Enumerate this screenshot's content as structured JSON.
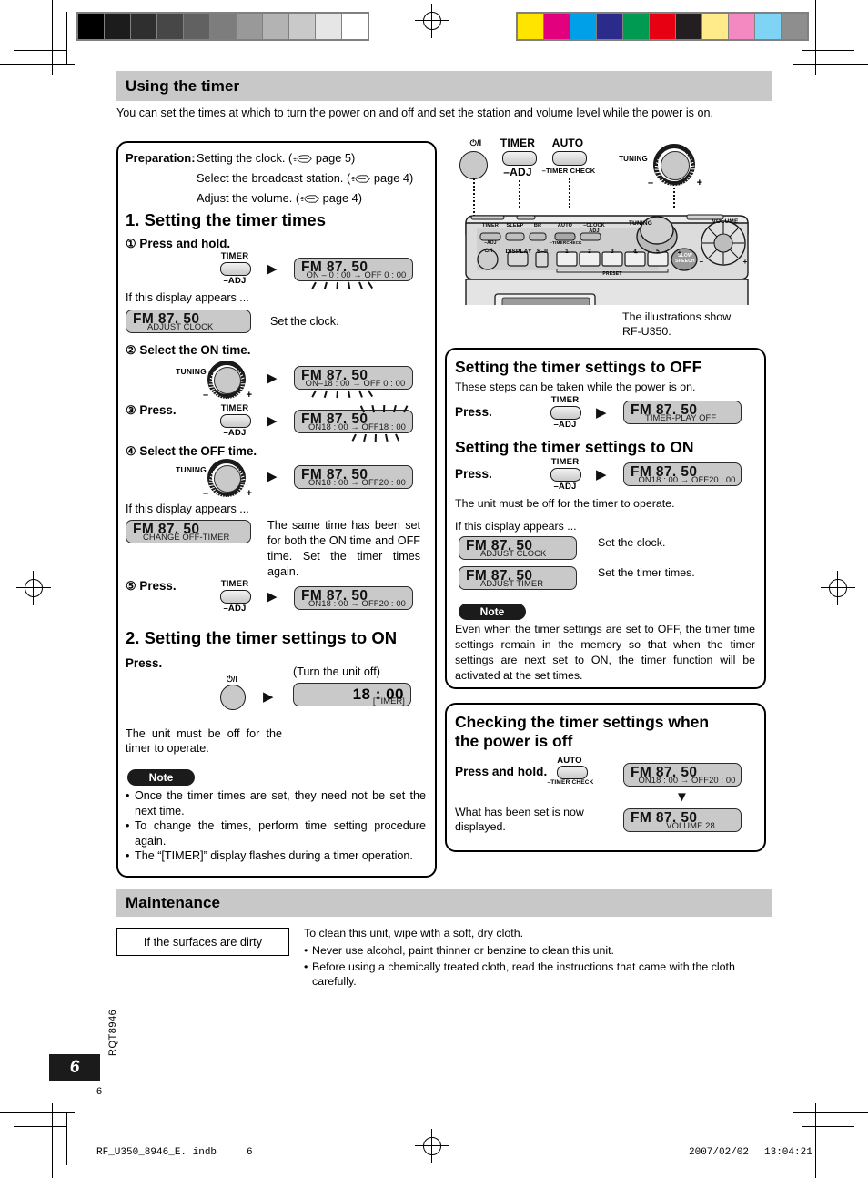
{
  "page": {
    "number_tab": "6",
    "number_small": "6",
    "doc_code": "RQT8946",
    "footer_file": "RF_U350_8946_E. indb     6",
    "footer_date": "2007/02/02",
    "footer_time": "13:04:21"
  },
  "calibration": {
    "gray_swatches": [
      "#000000",
      "#1c1c1c",
      "#2f2f2f",
      "#474747",
      "#616161",
      "#7d7d7d",
      "#999999",
      "#b3b3b3",
      "#c9c9c9",
      "#e6e6e6",
      "#ffffff"
    ],
    "color_swatches": [
      "#ffe400",
      "#e2007f",
      "#00a0e9",
      "#2b2b8c",
      "#009a52",
      "#e60012",
      "#231f20",
      "#ffeb8a",
      "#f488c1",
      "#7fd4f5",
      "#8e8e8e"
    ]
  },
  "sections": {
    "using_the_timer": {
      "title": "Using the timer",
      "intro": "You can set the times at which to turn the power on and off and set the station and volume level while the power is on."
    },
    "maintenance": {
      "title": "Maintenance",
      "left_box": "If the surfaces are dirty",
      "body_lead": "To clean this unit, wipe with a soft, dry cloth.",
      "bullets": [
        "Never use alcohol, paint thinner or benzine to clean this unit.",
        "Before using a chemically treated cloth, read the instructions that came with the cloth carefully."
      ]
    }
  },
  "preparation": {
    "label": "Preparation:",
    "lines": [
      {
        "text": "Setting the clock. (",
        "page": "page 5",
        "close": ")"
      },
      {
        "text": "Select the broadcast station. (",
        "page": "page 4",
        "close": ")"
      },
      {
        "text": "Adjust the volume. (",
        "page": "page 4",
        "close": ")"
      }
    ]
  },
  "illustration": {
    "caption_line1": "The illustrations show",
    "caption_line2": "RF-U350.",
    "callouts": {
      "power": "⏻/I",
      "timer": "TIMER",
      "timer_sub": "–ADJ",
      "auto": "AUTO",
      "auto_sub": "–TIMER CHECK",
      "tuning": "TUNING",
      "minus": "–",
      "plus": "+"
    },
    "panel": {
      "row1": [
        "TIMER",
        "SLEEP",
        "BR",
        "AUTO",
        "–CLOCK ADJ"
      ],
      "row1_subs": [
        "–ADJ",
        "",
        "",
        "–TIMERCHECK",
        ""
      ],
      "row2": [
        "⏻/I",
        "DISPLAY",
        "S–II"
      ],
      "presets": [
        "1",
        "2",
        "3",
        "4",
        "5"
      ],
      "preset_label": "PRESET",
      "slow_speech": "SLOW SPEECH",
      "tuning": "TUNING",
      "volume": "VOLUME"
    }
  },
  "step1": {
    "heading": "1. Setting the timer times",
    "items": [
      {
        "num": "①",
        "label": "Press and hold.",
        "control": "timer-button",
        "control_top": "TIMER",
        "control_bottom": "–ADJ"
      },
      {
        "num": "②",
        "label": "Select the ON time.",
        "control": "tuning-knob",
        "control_top": "TUNING"
      },
      {
        "num": "③",
        "label": "Press.",
        "control": "timer-button",
        "control_top": "TIMER",
        "control_bottom": "–ADJ"
      },
      {
        "num": "④",
        "label": "Select the OFF time.",
        "control": "tuning-knob",
        "control_top": "TUNING"
      },
      {
        "num": "⑤",
        "label": "Press.",
        "control": "timer-button",
        "control_top": "TIMER",
        "control_bottom": "–ADJ"
      }
    ],
    "displays": {
      "d1": {
        "fm": "FM  87. 50",
        "sub": "ON – 0 : 00 → OFF  0 : 00",
        "blink": true
      },
      "d2": {
        "fm": "FM  87. 50",
        "sub": "ADJUST CLOCK",
        "blink": false
      },
      "d3": {
        "fm": "FM  87. 50",
        "sub": "ON–18 : 00 → OFF  0 : 00",
        "blink": true
      },
      "d4": {
        "fm": "FM  87. 50",
        "sub": "ON18 : 00 → OFF18 : 00",
        "blink": true
      },
      "d5": {
        "fm": "FM  87. 50",
        "sub": "ON18 : 00 → OFF20 : 00",
        "blink": false
      },
      "d6": {
        "fm": "FM  87. 50",
        "sub": "CHANGE  OFF-TIMER",
        "blink": false
      },
      "d7": {
        "fm": "FM  87. 50",
        "sub": "ON18 : 00 → OFF20 : 00",
        "blink": false
      }
    },
    "notes": {
      "if_appears_1": "If this display appears ...",
      "set_the_clock": "Set the clock.",
      "if_appears_2": "If this display appears ...",
      "same_time_msg": "The same time has been set for both the ON time and OFF time. Set the timer times again."
    }
  },
  "step2": {
    "heading": "2. Setting the timer settings to ON",
    "press_label": "Press.",
    "turn_off_note": "(Turn the unit off)",
    "display": {
      "big": "18 : 00",
      "tag": "[TIMER]"
    },
    "must_be_off": "The unit must be off for the timer to operate.",
    "note_pill": "Note",
    "note_bullets": [
      "Once the timer times are set, they need not be set the next time.",
      "To change the times, perform time setting procedure again.",
      "The “[TIMER]” display flashes during a timer operation."
    ]
  },
  "timer_off_on": {
    "off_heading": "Setting the timer settings to OFF",
    "off_sub": "These steps can be taken while the power is on.",
    "off_press": "Press.",
    "off_control_top": "TIMER",
    "off_control_bottom": "–ADJ",
    "off_display": {
      "fm": "FM  87. 50",
      "sub": "TIMER-PLAY  OFF"
    },
    "on_heading": "Setting the timer settings to ON",
    "on_press": "Press.",
    "on_control_top": "TIMER",
    "on_control_bottom": "–ADJ",
    "on_display": {
      "fm": "FM  87. 50",
      "sub": "ON18 : 00 → OFF20 : 00"
    },
    "must_be_off": "The unit must be off for the timer to operate.",
    "if_appears": "If this display appears ...",
    "adjust_clock_display": {
      "fm": "FM  87. 50",
      "sub": "ADJUST CLOCK"
    },
    "adjust_clock_action": "Set the clock.",
    "adjust_timer_display": {
      "fm": "FM  87. 50",
      "sub": "ADJUST  TIMER"
    },
    "adjust_timer_action": "Set the timer times.",
    "note_pill": "Note",
    "note_text": "Even when the timer settings are set to OFF, the timer time settings remain in the memory so that when the timer settings are next set to ON, the timer function will be activated at the set times."
  },
  "checking": {
    "heading_line1": "Checking the timer settings when",
    "heading_line2": "the power is off",
    "press_label": "Press and hold.",
    "control_top": "AUTO",
    "control_bottom": "–TIMER CHECK",
    "display_top": {
      "fm": "FM  87. 50",
      "sub": "ON18 : 00 → OFF20 : 00"
    },
    "display_bottom": {
      "fm": "FM  87. 50",
      "sub": "VOLUME 28"
    },
    "result_line1": "What has been set is now",
    "result_line2": "displayed."
  }
}
